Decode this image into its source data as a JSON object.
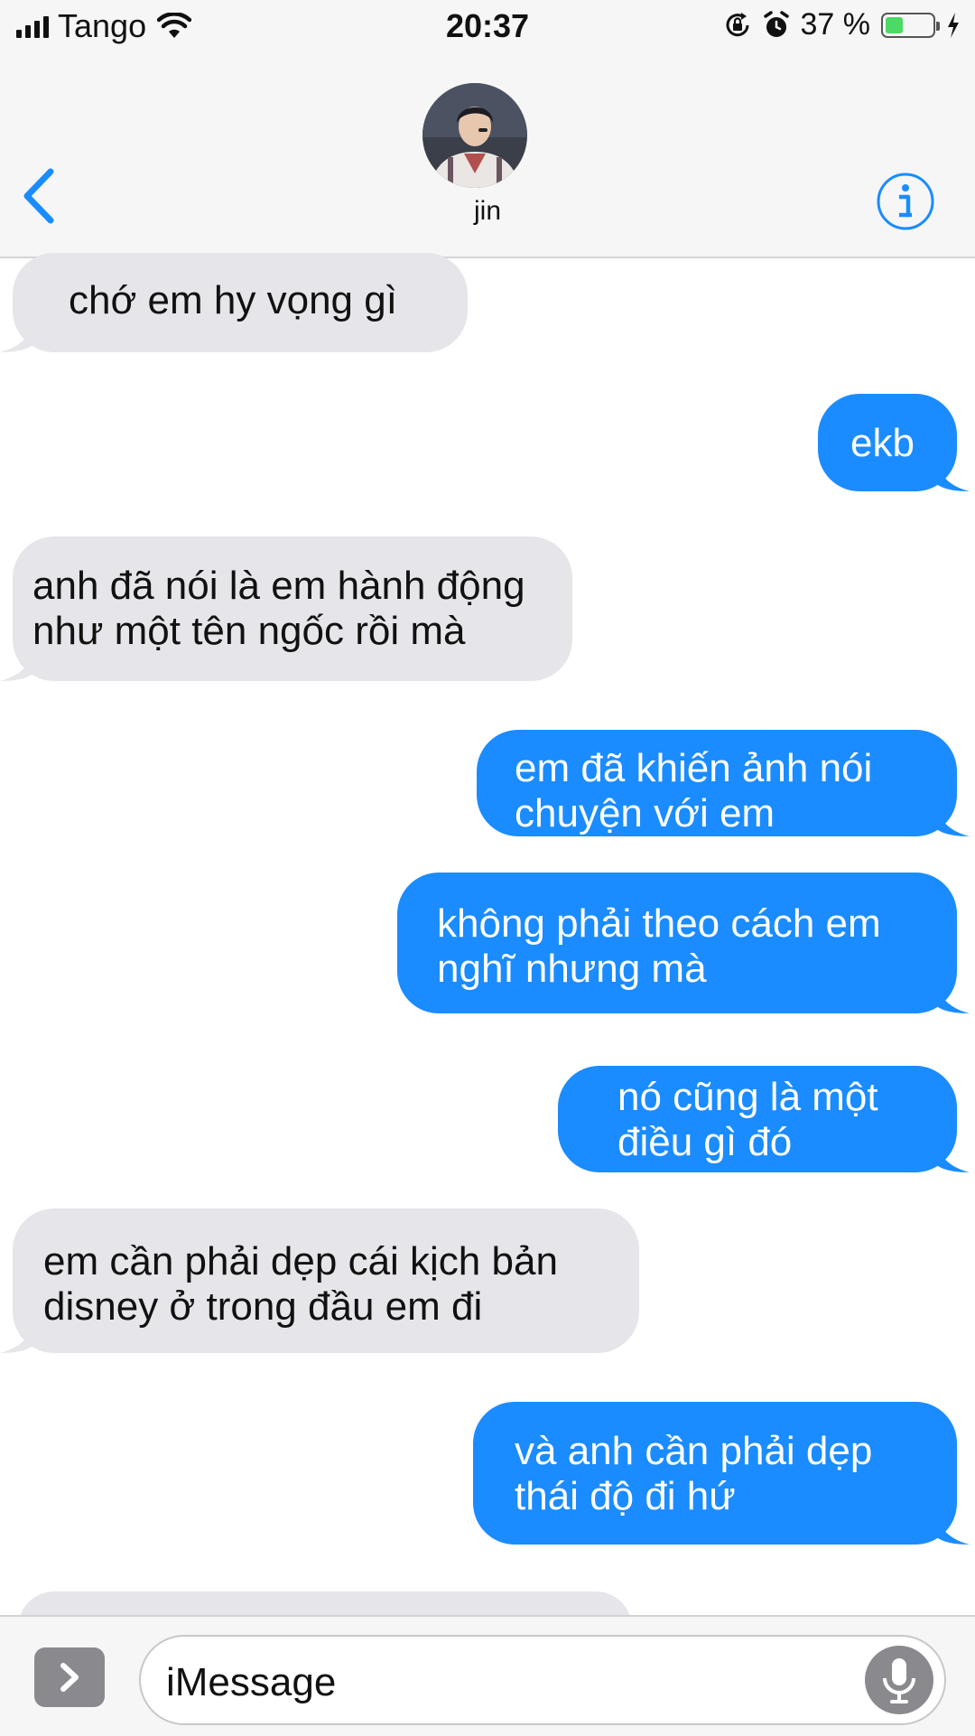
{
  "status": {
    "carrier": "Tango",
    "time": "20:37",
    "battery_percent": "37 %",
    "battery_level": 0.37,
    "battery_color": "#4cd964",
    "icons": [
      "signal-icon",
      "wifi-icon",
      "orientation-lock-icon",
      "alarm-icon",
      "battery-icon",
      "charging-icon"
    ]
  },
  "header": {
    "contact_name": "jin",
    "back_icon": "chevron-left-icon",
    "info_icon": "info-icon",
    "accent_color": "#1a8cff"
  },
  "messages": [
    {
      "side": "received",
      "text": "chớ em hy vọng gì"
    },
    {
      "side": "sent",
      "text": "ekb"
    },
    {
      "side": "received",
      "text": "anh đã nói là em hành động\nnhư một tên ngốc rồi mà"
    },
    {
      "side": "sent",
      "text": "em đã khiến ảnh nói\nchuyện với em"
    },
    {
      "side": "sent",
      "text": "không phải theo cách em\nnghĩ nhưng mà"
    },
    {
      "side": "sent",
      "text": "nó cũng là một\nđiều gì đó"
    },
    {
      "side": "received",
      "text": "em cần phải dẹp cái kịch bản\ndisney ở trong đầu em đi"
    },
    {
      "side": "sent",
      "text": "và anh cần phải dẹp\nthái độ đi hứ"
    }
  ],
  "input": {
    "placeholder": "iMessage",
    "expand_icon": "chevron-right-icon",
    "mic_icon": "microphone-icon"
  },
  "colors": {
    "sent_bubble": "#1a8cff",
    "received_bubble": "#e5e5ea",
    "bar_background": "#f6f6f6"
  }
}
